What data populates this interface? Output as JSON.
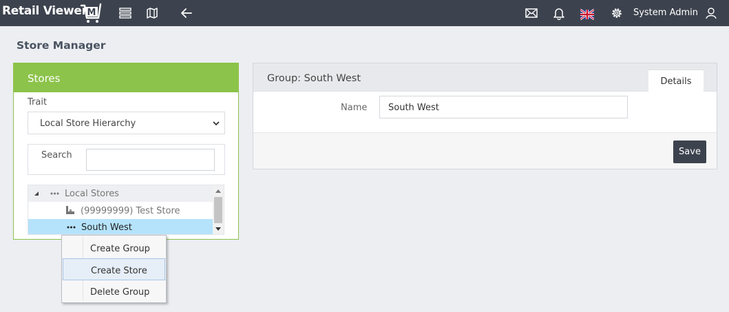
{
  "app": {
    "logo_text": "Retail Viewer",
    "logo_letter": "M",
    "user_name": "System Admin"
  },
  "page": {
    "title": "Store Manager"
  },
  "stores": {
    "header": "Stores",
    "trait_label": "Trait",
    "trait_value": "Local Store Hierarchy",
    "search_label": "Search",
    "search_value": "",
    "tree": [
      {
        "label": "Local Stores"
      },
      {
        "label": "(99999999) Test Store"
      },
      {
        "label": "South West"
      }
    ]
  },
  "context_menu": {
    "items": [
      "Create Group",
      "Create Store",
      "Delete Group"
    ],
    "highlighted": "Create Store"
  },
  "group": {
    "title": "Group: South West",
    "tab": "Details",
    "name_label": "Name",
    "name_value": "South West",
    "save_label": "Save"
  },
  "colors": {
    "topbar": "#3d434e",
    "panel_accent": "#8cc34a",
    "selected_row": "#b5e3fb"
  }
}
